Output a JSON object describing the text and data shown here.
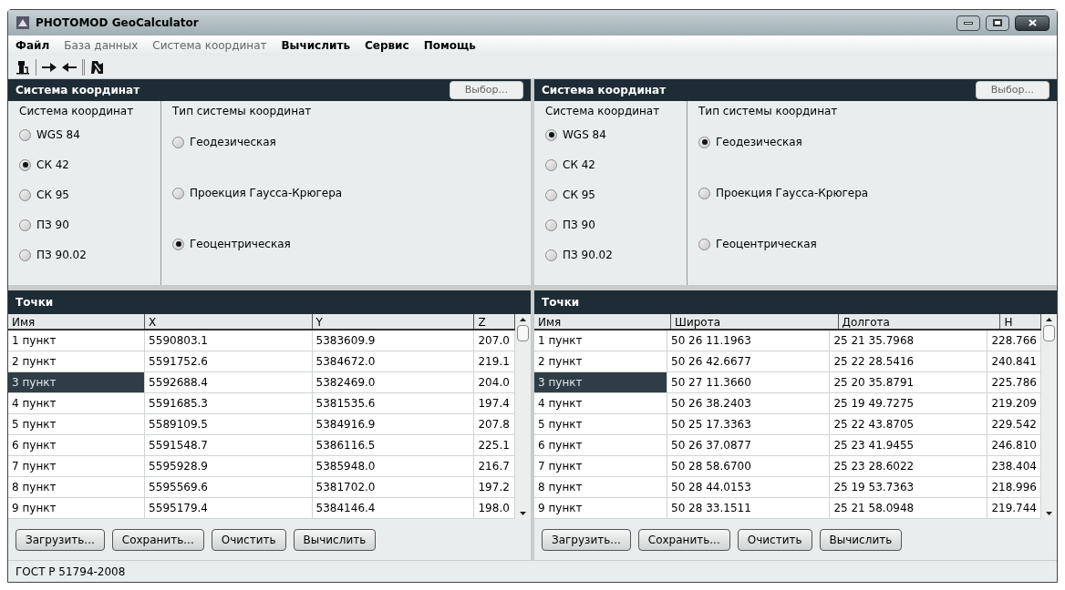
{
  "window": {
    "title": "PHOTOMOD GeoCalculator"
  },
  "menu": [
    {
      "label": "Файл",
      "disabled": false
    },
    {
      "label": "База данных",
      "disabled": true
    },
    {
      "label": "Система координат",
      "disabled": true
    },
    {
      "label": "Вычислить",
      "disabled": false
    },
    {
      "label": "Сервис",
      "disabled": false
    },
    {
      "label": "Помощь",
      "disabled": false
    }
  ],
  "panels": [
    {
      "coord_header": "Система координат",
      "choose_button": "Выбор...",
      "systems_label": "Система координат",
      "systems": [
        {
          "label": "WGS 84",
          "selected": false
        },
        {
          "label": "СК 42",
          "selected": true
        },
        {
          "label": "СК 95",
          "selected": false
        },
        {
          "label": "ПЗ 90",
          "selected": false
        },
        {
          "label": "ПЗ 90.02",
          "selected": false
        }
      ],
      "types_label": "Тип системы координат",
      "types": [
        {
          "label": "Геодезическая",
          "selected": false
        },
        {
          "label": "Проекция Гаусса-Крюгера",
          "selected": false
        },
        {
          "label": "Геоцентрическая",
          "selected": true
        }
      ],
      "points_header": "Точки",
      "columns": [
        "Имя",
        "X",
        "Y",
        "Z"
      ],
      "rows": [
        {
          "cells": [
            "1 пункт",
            "5590803.1",
            "5383609.9",
            "207.0"
          ],
          "selected": false
        },
        {
          "cells": [
            "2 пункт",
            "5591752.6",
            "5384672.0",
            "219.1"
          ],
          "selected": false
        },
        {
          "cells": [
            "3 пункт",
            "5592688.4",
            "5382469.0",
            "204.0"
          ],
          "selected": true
        },
        {
          "cells": [
            "4 пункт",
            "5591685.3",
            "5381535.6",
            "197.4"
          ],
          "selected": false
        },
        {
          "cells": [
            "5 пункт",
            "5589109.5",
            "5384916.9",
            "207.8"
          ],
          "selected": false
        },
        {
          "cells": [
            "6 пункт",
            "5591548.7",
            "5386116.5",
            "225.1"
          ],
          "selected": false
        },
        {
          "cells": [
            "7 пункт",
            "5595928.9",
            "5385948.0",
            "216.7"
          ],
          "selected": false
        },
        {
          "cells": [
            "8 пункт",
            "5595569.6",
            "5381702.0",
            "197.2"
          ],
          "selected": false
        },
        {
          "cells": [
            "9 пункт",
            "5595179.4",
            "5384146.4",
            "198.0"
          ],
          "selected": false
        }
      ],
      "buttons": [
        "Загрузить...",
        "Сохранить...",
        "Очистить",
        "Вычислить"
      ]
    },
    {
      "coord_header": "Система координат",
      "choose_button": "Выбор...",
      "systems_label": "Система координат",
      "systems": [
        {
          "label": "WGS 84",
          "selected": true
        },
        {
          "label": "СК 42",
          "selected": false
        },
        {
          "label": "СК 95",
          "selected": false
        },
        {
          "label": "ПЗ 90",
          "selected": false
        },
        {
          "label": "ПЗ 90.02",
          "selected": false
        }
      ],
      "types_label": "Тип системы координат",
      "types": [
        {
          "label": "Геодезическая",
          "selected": true
        },
        {
          "label": "Проекция Гаусса-Крюгера",
          "selected": false
        },
        {
          "label": "Геоцентрическая",
          "selected": false
        }
      ],
      "points_header": "Точки",
      "columns": [
        "Имя",
        "Широта",
        "Долгота",
        "H"
      ],
      "rows": [
        {
          "cells": [
            "1 пункт",
            "50 26 11.1963",
            "25 21 35.7968",
            "228.766"
          ],
          "selected": false
        },
        {
          "cells": [
            "2 пункт",
            "50 26 42.6677",
            "25 22 28.5416",
            "240.841"
          ],
          "selected": false
        },
        {
          "cells": [
            "3 пункт",
            "50 27 11.3660",
            "25 20 35.8791",
            "225.786"
          ],
          "selected": true
        },
        {
          "cells": [
            "4 пункт",
            "50 26 38.2403",
            "25 19 49.7275",
            "219.209"
          ],
          "selected": false
        },
        {
          "cells": [
            "5 пункт",
            "50 25 17.3363",
            "25 22 43.8705",
            "229.542"
          ],
          "selected": false
        },
        {
          "cells": [
            "6 пункт",
            "50 26 37.0877",
            "25 23 41.9455",
            "246.810"
          ],
          "selected": false
        },
        {
          "cells": [
            "7 пункт",
            "50 28 58.6700",
            "25 23 28.6022",
            "238.404"
          ],
          "selected": false
        },
        {
          "cells": [
            "8 пункт",
            "50 28 44.0153",
            "25 19 53.7363",
            "218.996"
          ],
          "selected": false
        },
        {
          "cells": [
            "9 пункт",
            "50 28 33.1511",
            "25 21 58.0948",
            "219.744"
          ],
          "selected": false
        }
      ],
      "buttons": [
        "Загрузить...",
        "Сохранить...",
        "Очистить",
        "Вычислить"
      ]
    }
  ],
  "status_bar": "ГОСТ Р 51794-2008"
}
